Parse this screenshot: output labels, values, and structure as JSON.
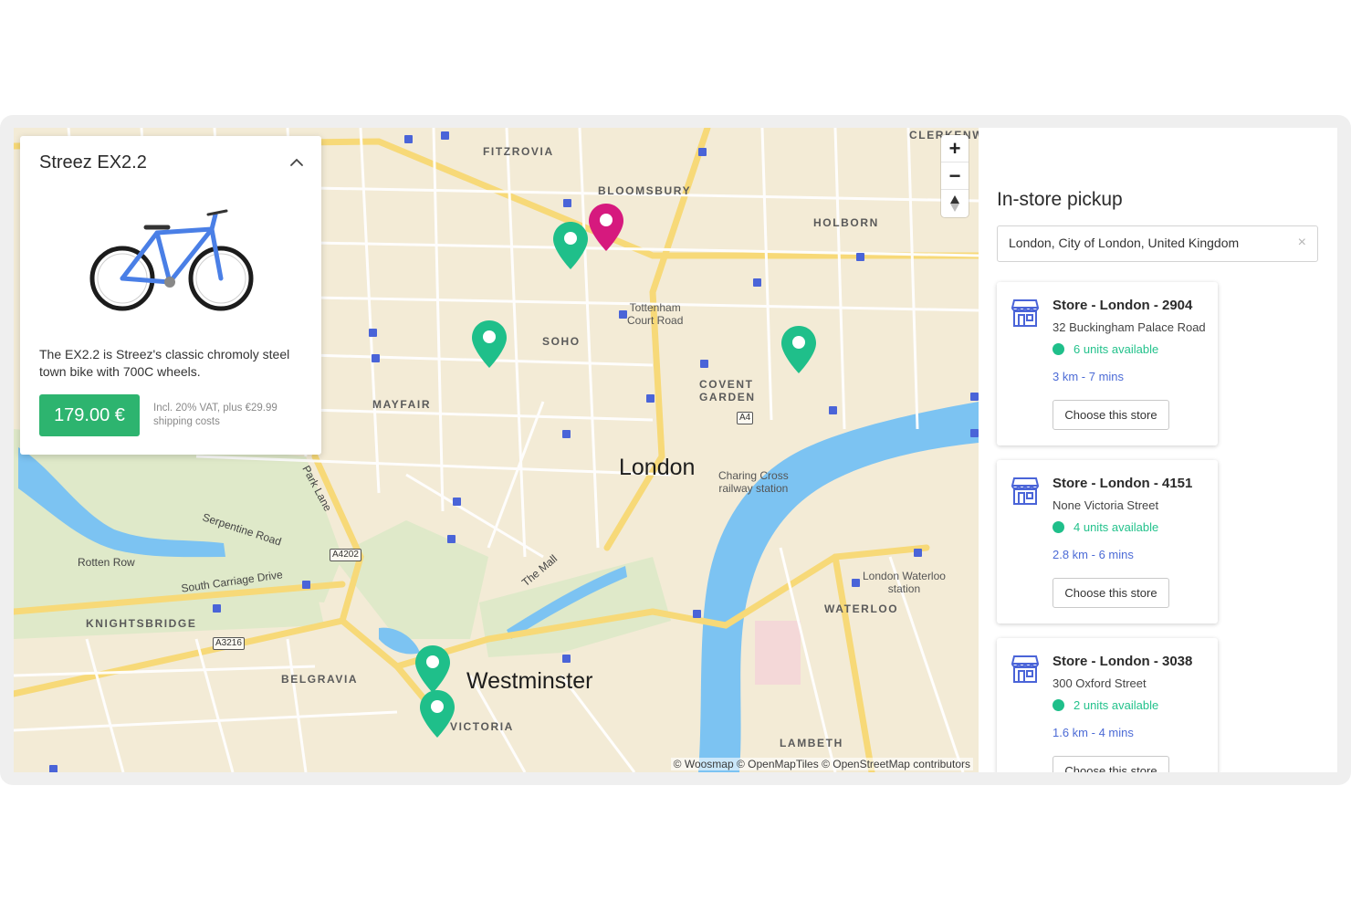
{
  "product": {
    "title": "Streez EX2.2",
    "description": "The EX2.2 is Streez's classic chromoly steel town bike with 700C wheels.",
    "price": "179.00 €",
    "vat_note": "Incl. 20% VAT, plus €29.99 shipping costs",
    "collapse_icon": "chevron-up-icon",
    "accent_color": "#2db46f"
  },
  "map": {
    "districts": [
      "FITZROVIA",
      "BLOOMSBURY",
      "HOLBORN",
      "SOHO",
      "MAYFAIR",
      "COVENT",
      "GARDEN",
      "KNIGHTSBRIDGE",
      "BELGRAVIA",
      "WATERLOO",
      "LAMBETH",
      "VICTORIA",
      "CLERKENWE"
    ],
    "cities": [
      "London",
      "Westminster"
    ],
    "places": {
      "tottenham": "Tottenham\nCourt Road",
      "charing": "Charing Cross\nrailway station",
      "waterloo_station": "London Waterloo\nstation"
    },
    "roads": [
      "Serpentine Road",
      "Rotten Row",
      "South Carriage Drive",
      "Park Lane",
      "The Mall"
    ],
    "road_numbers": [
      "A4",
      "A4202",
      "A3216"
    ],
    "attribution": "© Woosmap © OpenMapTiles © OpenStreetMap contributors",
    "zoom_in": "+",
    "zoom_out": "−",
    "pin_colors": {
      "store": "#1fbf8a",
      "selected": "#d6197e"
    }
  },
  "pickup": {
    "heading": "In-store pickup",
    "search_value": "London, City of London, United Kingdom",
    "clear_icon": "×",
    "stores": [
      {
        "name": "Store - London - 2904",
        "address": "32 Buckingham Palace Road",
        "availability": "6 units available",
        "distance": "3 km - 7 mins",
        "button": "Choose this store"
      },
      {
        "name": "Store - London - 4151",
        "address": "None Victoria Street",
        "availability": "4 units available",
        "distance": "2.8 km - 6 mins",
        "button": "Choose this store"
      },
      {
        "name": "Store - London - 3038",
        "address": "300 Oxford Street",
        "availability": "2 units available",
        "distance": "1.6 km - 4 mins",
        "button": "Choose this store"
      }
    ]
  }
}
